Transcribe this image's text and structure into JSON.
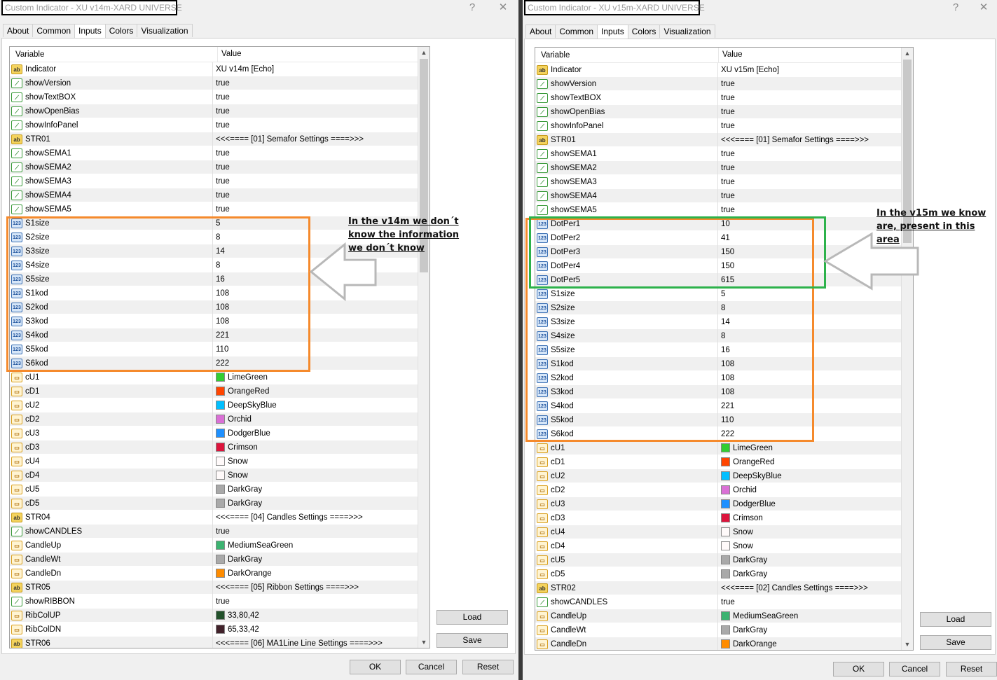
{
  "left": {
    "title": "Custom Indicator - XU v14m-XARD UNIVERSE",
    "help_glyph": "?",
    "close_glyph": "✕",
    "tabs": [
      "About",
      "Common",
      "Inputs",
      "Colors",
      "Visualization"
    ],
    "active_tab": "Inputs",
    "headers": {
      "variable": "Variable",
      "value": "Value"
    },
    "rows": [
      {
        "icon": "ab",
        "variable": "Indicator",
        "value": "XU v14m [Echo]"
      },
      {
        "icon": "bool",
        "variable": "showVersion",
        "value": "true"
      },
      {
        "icon": "bool",
        "variable": "showTextBOX",
        "value": "true"
      },
      {
        "icon": "bool",
        "variable": "showOpenBias",
        "value": "true"
      },
      {
        "icon": "bool",
        "variable": "showInfoPanel",
        "value": "true"
      },
      {
        "icon": "ab",
        "variable": "STR01",
        "value": "<<<==== [01] Semafor Settings ====>>>"
      },
      {
        "icon": "bool",
        "variable": "showSEMA1",
        "value": "true"
      },
      {
        "icon": "bool",
        "variable": "showSEMA2",
        "value": "true"
      },
      {
        "icon": "bool",
        "variable": "showSEMA3",
        "value": "true"
      },
      {
        "icon": "bool",
        "variable": "showSEMA4",
        "value": "true"
      },
      {
        "icon": "bool",
        "variable": "showSEMA5",
        "value": "true"
      },
      {
        "icon": "int",
        "variable": "S1size",
        "value": "5"
      },
      {
        "icon": "int",
        "variable": "S2size",
        "value": "8"
      },
      {
        "icon": "int",
        "variable": "S3size",
        "value": "14"
      },
      {
        "icon": "int",
        "variable": "S4size",
        "value": "8"
      },
      {
        "icon": "int",
        "variable": "S5size",
        "value": "16"
      },
      {
        "icon": "int",
        "variable": "S1kod",
        "value": "108"
      },
      {
        "icon": "int",
        "variable": "S2kod",
        "value": "108"
      },
      {
        "icon": "int",
        "variable": "S3kod",
        "value": "108"
      },
      {
        "icon": "int",
        "variable": "S4kod",
        "value": "221"
      },
      {
        "icon": "int",
        "variable": "S5kod",
        "value": "110"
      },
      {
        "icon": "int",
        "variable": "S6kod",
        "value": "222"
      },
      {
        "icon": "color",
        "variable": "cU1",
        "value": "LimeGreen",
        "swatch": "#32cd32"
      },
      {
        "icon": "color",
        "variable": "cD1",
        "value": "OrangeRed",
        "swatch": "#ff4500"
      },
      {
        "icon": "color",
        "variable": "cU2",
        "value": "DeepSkyBlue",
        "swatch": "#00bfff"
      },
      {
        "icon": "color",
        "variable": "cD2",
        "value": "Orchid",
        "swatch": "#da70d6"
      },
      {
        "icon": "color",
        "variable": "cU3",
        "value": "DodgerBlue",
        "swatch": "#1e90ff"
      },
      {
        "icon": "color",
        "variable": "cD3",
        "value": "Crimson",
        "swatch": "#dc143c"
      },
      {
        "icon": "color",
        "variable": "cU4",
        "value": "Snow",
        "swatch": "#fffafa"
      },
      {
        "icon": "color",
        "variable": "cD4",
        "value": "Snow",
        "swatch": "#fffafa"
      },
      {
        "icon": "color",
        "variable": "cU5",
        "value": "DarkGray",
        "swatch": "#a9a9a9"
      },
      {
        "icon": "color",
        "variable": "cD5",
        "value": "DarkGray",
        "swatch": "#a9a9a9"
      },
      {
        "icon": "ab",
        "variable": "STR04",
        "value": "<<<==== [04] Candles Settings ====>>>"
      },
      {
        "icon": "bool",
        "variable": "showCANDLES",
        "value": "true"
      },
      {
        "icon": "color",
        "variable": "CandleUp",
        "value": "MediumSeaGreen",
        "swatch": "#3cb371"
      },
      {
        "icon": "color",
        "variable": "CandleWt",
        "value": "DarkGray",
        "swatch": "#a9a9a9"
      },
      {
        "icon": "color",
        "variable": "CandleDn",
        "value": "DarkOrange",
        "swatch": "#ff8c00"
      },
      {
        "icon": "ab",
        "variable": "STR05",
        "value": "<<<==== [05] Ribbon Settings ====>>>"
      },
      {
        "icon": "bool",
        "variable": "showRIBBON",
        "value": "true"
      },
      {
        "icon": "color",
        "variable": "RibColUP",
        "value": "33,80,42",
        "swatch": "#21502a"
      },
      {
        "icon": "color",
        "variable": "RibColDN",
        "value": "65,33,42",
        "swatch": "#41212a"
      },
      {
        "icon": "ab",
        "variable": "STR06",
        "value": "<<<==== [06] MA1Line Line Settings ====>>>"
      }
    ],
    "buttons": {
      "load": "Load",
      "save": "Save",
      "ok": "OK",
      "cancel": "Cancel",
      "reset": "Reset"
    },
    "annotation": [
      "In the v14m we don´t",
      "know the information",
      "we don´t know"
    ]
  },
  "right": {
    "title": "Custom Indicator - XU v15m-XARD UNIVERSE",
    "help_glyph": "?",
    "close_glyph": "✕",
    "tabs": [
      "About",
      "Common",
      "Inputs",
      "Colors",
      "Visualization"
    ],
    "active_tab": "Inputs",
    "headers": {
      "variable": "Variable",
      "value": "Value"
    },
    "rows": [
      {
        "icon": "ab",
        "variable": "Indicator",
        "value": "XU v15m [Echo]"
      },
      {
        "icon": "bool",
        "variable": "showVersion",
        "value": "true"
      },
      {
        "icon": "bool",
        "variable": "showTextBOX",
        "value": "true"
      },
      {
        "icon": "bool",
        "variable": "showOpenBias",
        "value": "true"
      },
      {
        "icon": "bool",
        "variable": "showInfoPanel",
        "value": "true"
      },
      {
        "icon": "ab",
        "variable": "STR01",
        "value": "<<<==== [01] Semafor Settings ====>>>"
      },
      {
        "icon": "bool",
        "variable": "showSEMA1",
        "value": "true"
      },
      {
        "icon": "bool",
        "variable": "showSEMA2",
        "value": "true"
      },
      {
        "icon": "bool",
        "variable": "showSEMA3",
        "value": "true"
      },
      {
        "icon": "bool",
        "variable": "showSEMA4",
        "value": "true"
      },
      {
        "icon": "bool",
        "variable": "showSEMA5",
        "value": "true"
      },
      {
        "icon": "int",
        "variable": "DotPer1",
        "value": "10"
      },
      {
        "icon": "int",
        "variable": "DotPer2",
        "value": "41"
      },
      {
        "icon": "int",
        "variable": "DotPer3",
        "value": "150"
      },
      {
        "icon": "int",
        "variable": "DotPer4",
        "value": "150"
      },
      {
        "icon": "int",
        "variable": "DotPer5",
        "value": "615"
      },
      {
        "icon": "int",
        "variable": "S1size",
        "value": "5"
      },
      {
        "icon": "int",
        "variable": "S2size",
        "value": "8"
      },
      {
        "icon": "int",
        "variable": "S3size",
        "value": "14"
      },
      {
        "icon": "int",
        "variable": "S4size",
        "value": "8"
      },
      {
        "icon": "int",
        "variable": "S5size",
        "value": "16"
      },
      {
        "icon": "int",
        "variable": "S1kod",
        "value": "108"
      },
      {
        "icon": "int",
        "variable": "S2kod",
        "value": "108"
      },
      {
        "icon": "int",
        "variable": "S3kod",
        "value": "108"
      },
      {
        "icon": "int",
        "variable": "S4kod",
        "value": "221"
      },
      {
        "icon": "int",
        "variable": "S5kod",
        "value": "110"
      },
      {
        "icon": "int",
        "variable": "S6kod",
        "value": "222"
      },
      {
        "icon": "color",
        "variable": "cU1",
        "value": "LimeGreen",
        "swatch": "#32cd32"
      },
      {
        "icon": "color",
        "variable": "cD1",
        "value": "OrangeRed",
        "swatch": "#ff4500"
      },
      {
        "icon": "color",
        "variable": "cU2",
        "value": "DeepSkyBlue",
        "swatch": "#00bfff"
      },
      {
        "icon": "color",
        "variable": "cD2",
        "value": "Orchid",
        "swatch": "#da70d6"
      },
      {
        "icon": "color",
        "variable": "cU3",
        "value": "DodgerBlue",
        "swatch": "#1e90ff"
      },
      {
        "icon": "color",
        "variable": "cD3",
        "value": "Crimson",
        "swatch": "#dc143c"
      },
      {
        "icon": "color",
        "variable": "cU4",
        "value": "Snow",
        "swatch": "#fffafa"
      },
      {
        "icon": "color",
        "variable": "cD4",
        "value": "Snow",
        "swatch": "#fffafa"
      },
      {
        "icon": "color",
        "variable": "cU5",
        "value": "DarkGray",
        "swatch": "#a9a9a9"
      },
      {
        "icon": "color",
        "variable": "cD5",
        "value": "DarkGray",
        "swatch": "#a9a9a9"
      },
      {
        "icon": "ab",
        "variable": "STR02",
        "value": "<<<==== [02] Candles Settings ====>>>"
      },
      {
        "icon": "bool",
        "variable": "showCANDLES",
        "value": "true"
      },
      {
        "icon": "color",
        "variable": "CandleUp",
        "value": "MediumSeaGreen",
        "swatch": "#3cb371"
      },
      {
        "icon": "color",
        "variable": "CandleWt",
        "value": "DarkGray",
        "swatch": "#a9a9a9"
      },
      {
        "icon": "color",
        "variable": "CandleDn",
        "value": "DarkOrange",
        "swatch": "#ff8c00"
      }
    ],
    "buttons": {
      "load": "Load",
      "save": "Save",
      "ok": "OK",
      "cancel": "Cancel",
      "reset": "Reset"
    },
    "annotation": [
      "In the v15m we know",
      "are, present in this",
      "area"
    ]
  },
  "colors": {
    "highlight_orange": "#f58a2c",
    "highlight_green": "#2db24b"
  }
}
